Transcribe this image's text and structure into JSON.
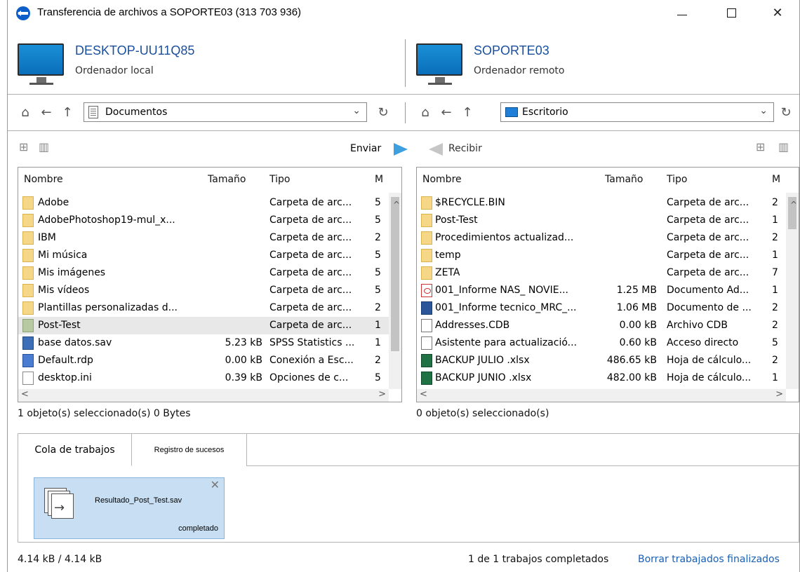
{
  "window": {
    "title": "Transferencia de archivos a SOPORTE03 (313 703 936)",
    "controls": {
      "minimize": "",
      "maximize": "",
      "close": "✕"
    }
  },
  "local": {
    "name": "DESKTOP-UU11Q85",
    "role": "Ordenador local",
    "path": "Documentos",
    "status": "1 objeto(s) seleccionado(s)  0 Bytes",
    "send_label": "Enviar",
    "columns": [
      "Nombre",
      "Tamaño",
      "Tipo",
      "M"
    ],
    "rows": [
      {
        "name": "Adobe",
        "size": "",
        "type": "Carpeta de arc...",
        "mod": "5",
        "icon": "folder-icon"
      },
      {
        "name": "AdobePhotoshop19-mul_x...",
        "size": "",
        "type": "Carpeta de arc...",
        "mod": "5",
        "icon": "folder-icon"
      },
      {
        "name": "IBM",
        "size": "",
        "type": "Carpeta de arc...",
        "mod": "2",
        "icon": "folder-icon"
      },
      {
        "name": "Mi música",
        "size": "",
        "type": "Carpeta de arc...",
        "mod": "5",
        "icon": "folder-icon"
      },
      {
        "name": "Mis imágenes",
        "size": "",
        "type": "Carpeta de arc...",
        "mod": "5",
        "icon": "folder-icon"
      },
      {
        "name": "Mis vídeos",
        "size": "",
        "type": "Carpeta de arc...",
        "mod": "5",
        "icon": "folder-icon"
      },
      {
        "name": "Plantillas personalizadas d...",
        "size": "",
        "type": "Carpeta de arc...",
        "mod": "2",
        "icon": "folder-icon"
      },
      {
        "name": "Post-Test",
        "size": "",
        "type": "Carpeta de arc...",
        "mod": "1",
        "icon": "folder-icon",
        "selected": true
      },
      {
        "name": "base datos.sav",
        "size": "5.23 kB",
        "type": "SPSS Statistics ...",
        "mod": "1",
        "icon": "spss-file-icon"
      },
      {
        "name": "Default.rdp",
        "size": "0.00 kB",
        "type": "Conexión a Esc...",
        "mod": "2",
        "icon": "rdp-file-icon"
      },
      {
        "name": "desktop.ini",
        "size": "0.39 kB",
        "type": "Opciones de c...",
        "mod": "5",
        "icon": "ini-file-icon"
      }
    ]
  },
  "remote": {
    "name": "SOPORTE03",
    "role": "Ordenador remoto",
    "path": "Escritorio",
    "status": "0 objeto(s) seleccionado(s)",
    "receive_label": "Recibir",
    "columns": [
      "Nombre",
      "Tamaño",
      "Tipo",
      "M"
    ],
    "rows": [
      {
        "name": "$RECYCLE.BIN",
        "size": "",
        "type": "Carpeta de arc...",
        "mod": "2",
        "icon": "folder-icon"
      },
      {
        "name": "Post-Test",
        "size": "",
        "type": "Carpeta de arc...",
        "mod": "1",
        "icon": "folder-icon"
      },
      {
        "name": "Procedimientos actualizad...",
        "size": "",
        "type": "Carpeta de arc...",
        "mod": "2",
        "icon": "folder-icon"
      },
      {
        "name": "temp",
        "size": "",
        "type": "Carpeta de arc...",
        "mod": "1",
        "icon": "folder-icon"
      },
      {
        "name": "ZETA",
        "size": "",
        "type": "Carpeta de arc...",
        "mod": "7",
        "icon": "folder-icon"
      },
      {
        "name": "001_Informe NAS_ NOVIE...",
        "size": "1.25 MB",
        "type": "Documento Ad...",
        "mod": "1",
        "icon": "pdf-file-icon"
      },
      {
        "name": "001_Informe tecnico_MRC_...",
        "size": "1.06 MB",
        "type": "Documento de ...",
        "mod": "2",
        "icon": "word-file-icon"
      },
      {
        "name": "Addresses.CDB",
        "size": "0.00 kB",
        "type": "Archivo CDB",
        "mod": "2",
        "icon": "shortcut-file-icon"
      },
      {
        "name": "Asistente para actualizació...",
        "size": "0.60 kB",
        "type": "Acceso directo",
        "mod": "5",
        "icon": "shortcut-file-icon"
      },
      {
        "name": "BACKUP JULIO .xlsx",
        "size": "486.65 kB",
        "type": "Hoja de cálculo...",
        "mod": "2",
        "icon": "excel-file-icon"
      },
      {
        "name": "BACKUP JUNIO .xlsx",
        "size": "482.00 kB",
        "type": "Hoja de cálculo...",
        "mod": "1",
        "icon": "excel-file-icon"
      }
    ]
  },
  "jobs": {
    "tabs": [
      "Cola de trabajos",
      "Registro de sucesos"
    ],
    "card": {
      "file": "Resultado_Post_Test.sav",
      "state": "completado"
    }
  },
  "footer": {
    "progress": "4.14 kB / 4.14 kB",
    "summary": "1 de 1 trabajos completados",
    "clear_link": "Borrar trabajados finalizados"
  }
}
